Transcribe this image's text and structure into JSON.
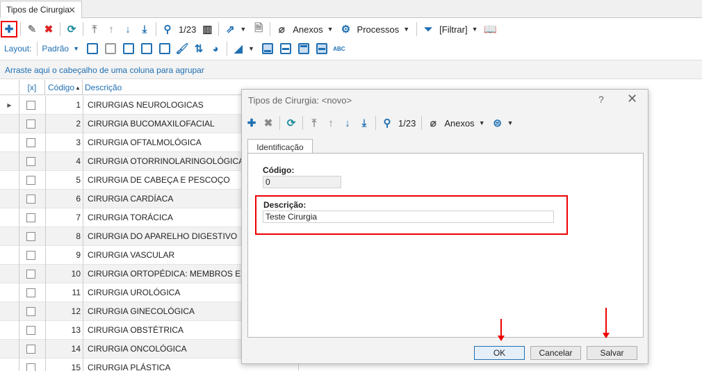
{
  "tab": {
    "title": "Tipos de Cirurgia",
    "close": "✕"
  },
  "toolbar": {
    "record_position": "1/23",
    "anexos_label": "Anexos",
    "processos_label": "Processos",
    "filtrar_label": "[Filtrar]"
  },
  "layout_bar": {
    "label": "Layout:",
    "value": "Padrão"
  },
  "group_panel": {
    "hint": "Arraste aqui o cabeçalho de uma coluna para agrupar"
  },
  "grid": {
    "headers": {
      "check": "[x]",
      "code": "Código",
      "desc": "Descrição"
    },
    "rows": [
      {
        "code": "1",
        "desc": "CIRURGIAS NEUROLOGICAS"
      },
      {
        "code": "2",
        "desc": "CIRURGIA BUCOMAXILOFACIAL"
      },
      {
        "code": "3",
        "desc": "CIRURGIA OFTALMOLÓGICA"
      },
      {
        "code": "4",
        "desc": "CIRURGIA OTORRINOLARINGOLÓGICA"
      },
      {
        "code": "5",
        "desc": "CIRURGIA DE CABEÇA E PESCOÇO"
      },
      {
        "code": "6",
        "desc": "CIRURGIA CARDÍACA"
      },
      {
        "code": "7",
        "desc": "CIRURGIA TORÁCICA"
      },
      {
        "code": "8",
        "desc": "CIRURGIA DO APARELHO DIGESTIVO"
      },
      {
        "code": "9",
        "desc": "CIRURGIA VASCULAR"
      },
      {
        "code": "10",
        "desc": "CIRURGIA ORTOPÉDICA: MEMBROS E COLUNA"
      },
      {
        "code": "11",
        "desc": "CIRURGIA UROLÓGICA"
      },
      {
        "code": "12",
        "desc": "CIRURGIA GINECOLÓGICA"
      },
      {
        "code": "13",
        "desc": "CIRURGIA OBSTÉTRICA"
      },
      {
        "code": "14",
        "desc": "CIRURGIA ONCOLÓGICA"
      },
      {
        "code": "15",
        "desc": "CIRURGIA PLÁSTICA"
      }
    ]
  },
  "dialog": {
    "title": "Tipos de Cirurgia: <novo>",
    "help": "?",
    "close": "✕",
    "record_position": "1/23",
    "anexos_label": "Anexos",
    "tab_label": "Identificação",
    "codigo_label": "Código:",
    "codigo_value": "0",
    "descricao_label": "Descrição:",
    "descricao_value": "Teste Cirurgia",
    "ok_label": "OK",
    "cancel_label": "Cancelar",
    "save_label": "Salvar"
  },
  "colors": {
    "accent": "#1f6fb2",
    "highlight": "#e00000"
  }
}
